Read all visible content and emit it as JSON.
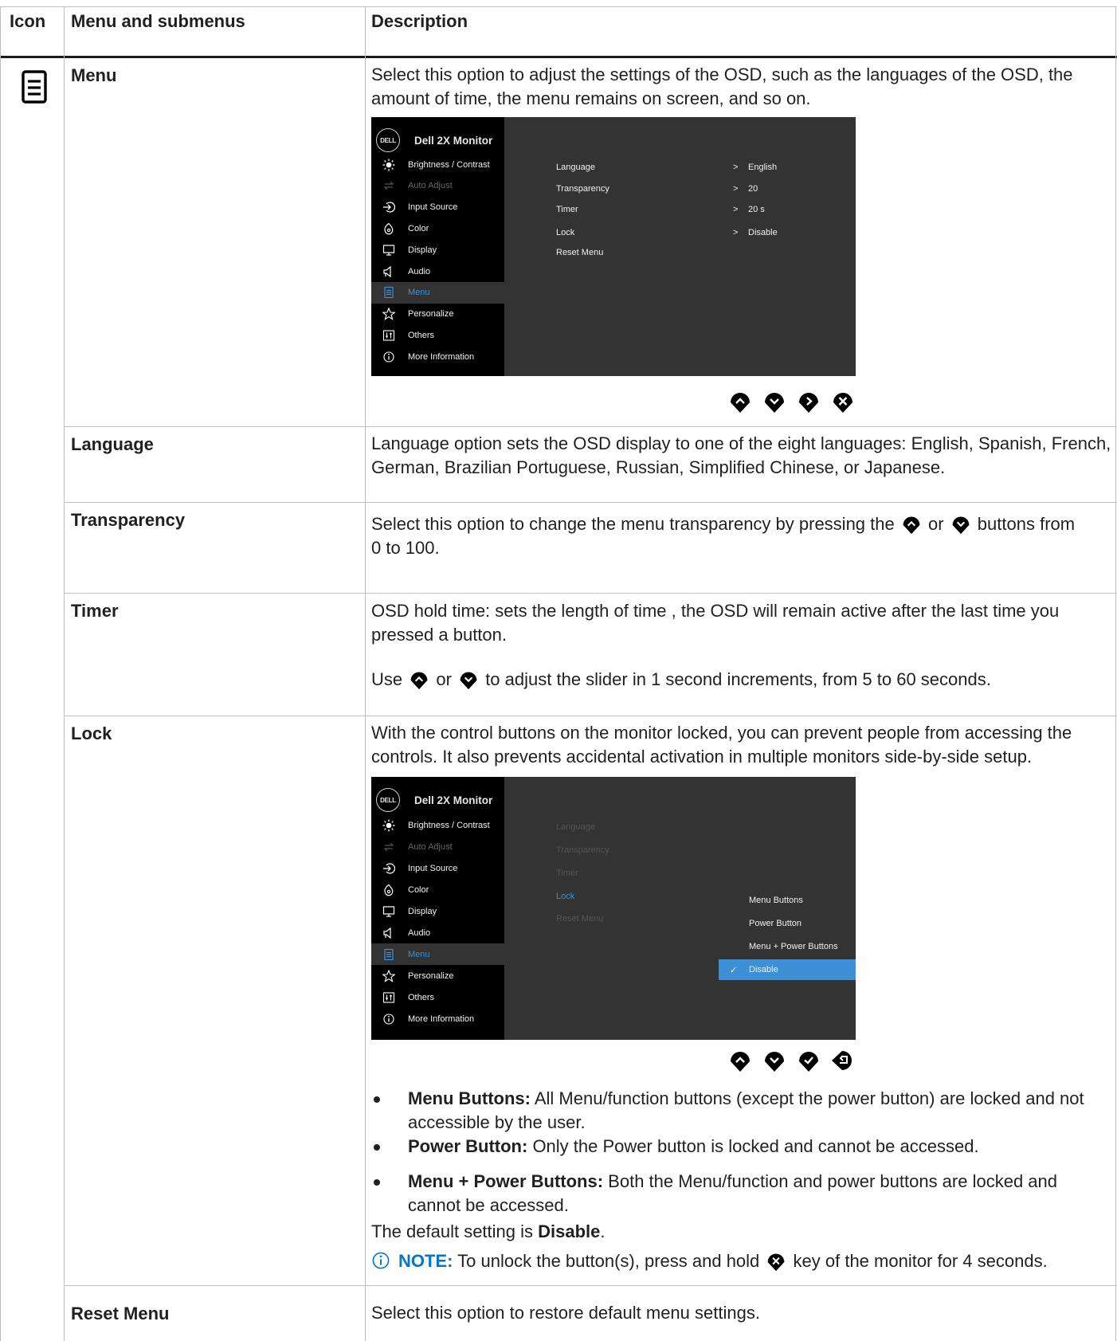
{
  "headers": {
    "icon": "Icon",
    "menu": "Menu and submenus",
    "description": "Description"
  },
  "menu_row": {
    "icon": "menu-list-icon",
    "name": "Menu",
    "description": "Select this option to adjust the settings of the OSD, such as the languages of the OSD, the amount of time, the menu remains on screen, and so on."
  },
  "osd": {
    "logo": "DELL",
    "title": "Dell 2X Monitor",
    "sidebar": [
      {
        "label": "Brightness / Contrast",
        "icon": "sun-icon",
        "state": "normal"
      },
      {
        "label": "Auto Adjust",
        "icon": "auto-adjust-icon",
        "state": "dim"
      },
      {
        "label": "Input Source",
        "icon": "input-source-icon",
        "state": "normal"
      },
      {
        "label": "Color",
        "icon": "palette-icon",
        "state": "normal"
      },
      {
        "label": "Display",
        "icon": "monitor-icon",
        "state": "normal"
      },
      {
        "label": "Audio",
        "icon": "speaker-icon",
        "state": "normal"
      },
      {
        "label": "Menu",
        "icon": "menu-list-icon",
        "state": "selected"
      },
      {
        "label": "Personalize",
        "icon": "star-icon",
        "state": "normal"
      },
      {
        "label": "Others",
        "icon": "others-icon",
        "state": "normal"
      },
      {
        "label": "More Information",
        "icon": "info-icon",
        "state": "normal"
      }
    ],
    "settings": [
      {
        "label": "Language",
        "value": "English"
      },
      {
        "label": "Transparency",
        "value": "20"
      },
      {
        "label": "Timer",
        "value": "20 s"
      },
      {
        "label": "Lock",
        "value": "Disable"
      },
      {
        "label": "Reset Menu",
        "value": ""
      }
    ],
    "arrow": ">"
  },
  "nav_buttons_1": [
    "up-button-icon",
    "down-button-icon",
    "right-button-icon",
    "close-button-icon"
  ],
  "language_row": {
    "name": "Language",
    "description": "Language option sets the OSD display to one of the eight languages: English, Spanish, French, German, Brazilian Portuguese, Russian, Simplified Chinese, or Japanese."
  },
  "transparency_row": {
    "name": "Transparency",
    "desc_a": "Select this option to change the menu transparency by pressing the",
    "desc_or": "or",
    "desc_b": "buttons from",
    "desc_c": "0 to 100."
  },
  "timer_row": {
    "name": "Timer",
    "desc1": "OSD hold time: sets the length of time , the OSD will remain active after the last time you pressed a button.",
    "use": "Use",
    "or": "or",
    "desc2": "to adjust the slider in 1 second increments, from 5 to 60 seconds."
  },
  "lock_row": {
    "name": "Lock",
    "description": "With the control buttons on the monitor locked, you can prevent people from accessing the controls. It also prevents accidental activation in multiple monitors side-by-side setup.",
    "osd_settings": [
      "Language",
      "Transparency",
      "Timer",
      "Lock",
      "Reset Menu"
    ],
    "options": [
      "Menu Buttons",
      "Power Button",
      "Menu + Power Buttons",
      "Disable"
    ],
    "selected_option": "Disable",
    "check": "✓",
    "bullets": [
      {
        "term": "Menu Buttons:",
        "text": " All Menu/function buttons (except the power button) are locked and not accessible by the user."
      },
      {
        "term": "Power Button:",
        "text": " Only the Power button is locked and cannot be accessed."
      },
      {
        "term": "Menu + Power Buttons:",
        "text": " Both the Menu/function and power buttons are locked and cannot be accessed."
      }
    ],
    "default_prefix": "The default setting is ",
    "default_value": "Disable",
    "default_suffix": ".",
    "note_label": "NOTE:",
    "note_a": " To unlock the button(s), press and hold ",
    "note_b": " key of the monitor for 4 seconds."
  },
  "nav_buttons_2": [
    "up-button-icon",
    "down-button-icon",
    "check-button-icon",
    "back-button-icon"
  ],
  "reset_row": {
    "name": "Reset Menu",
    "description": "Select this option to restore default menu settings."
  },
  "colors": {
    "osd_accent": "#3d8fd6",
    "osd_bg": "#333333",
    "osd_sidebar": "#000000"
  }
}
